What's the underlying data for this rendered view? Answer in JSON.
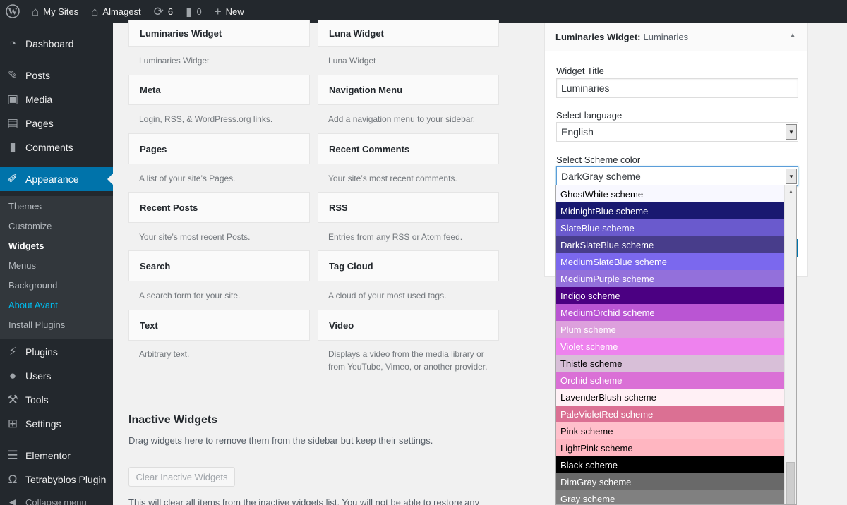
{
  "adminbar": {
    "my_sites": "My Sites",
    "site_name": "Almagest",
    "updates_count": "6",
    "comments_count": "0",
    "new_label": "New"
  },
  "sidebar": {
    "menu": [
      {
        "label": "Dashboard",
        "icon": "dashboard-icon"
      },
      {
        "label": "Posts",
        "icon": "pin-icon"
      },
      {
        "label": "Media",
        "icon": "media-icon"
      },
      {
        "label": "Pages",
        "icon": "pages-icon"
      },
      {
        "label": "Comments",
        "icon": "comment-icon"
      },
      {
        "label": "Appearance",
        "icon": "brush-icon"
      },
      {
        "label": "Plugins",
        "icon": "plugin-icon"
      },
      {
        "label": "Users",
        "icon": "user-icon"
      },
      {
        "label": "Tools",
        "icon": "wrench-icon"
      },
      {
        "label": "Settings",
        "icon": "settings-icon"
      },
      {
        "label": "Elementor",
        "icon": "elementor-icon"
      },
      {
        "label": "Tetrabyblos Plugin",
        "icon": "omega-icon"
      }
    ],
    "submenu": [
      "Themes",
      "Customize",
      "Widgets",
      "Menus",
      "Background",
      "About Avant",
      "Install Plugins"
    ],
    "collapse": "Collapse menu"
  },
  "widgets": [
    {
      "title": "Luminaries Widget",
      "desc": "Luminaries Widget"
    },
    {
      "title": "Luna Widget",
      "desc": "Luna Widget"
    },
    {
      "title": "Meta",
      "desc": "Login, RSS, & WordPress.org links."
    },
    {
      "title": "Navigation Menu",
      "desc": "Add a navigation menu to your sidebar."
    },
    {
      "title": "Pages",
      "desc": "A list of your site’s Pages."
    },
    {
      "title": "Recent Comments",
      "desc": "Your site’s most recent comments."
    },
    {
      "title": "Recent Posts",
      "desc": "Your site’s most recent Posts."
    },
    {
      "title": "RSS",
      "desc": "Entries from any RSS or Atom feed."
    },
    {
      "title": "Search",
      "desc": "A search form for your site."
    },
    {
      "title": "Tag Cloud",
      "desc": "A cloud of your most used tags."
    },
    {
      "title": "Text",
      "desc": "Arbitrary text."
    },
    {
      "title": "Video",
      "desc": "Displays a video from the media library or from YouTube, Vimeo, or another provider."
    }
  ],
  "inactive": {
    "title": "Inactive Widgets",
    "desc": "Drag widgets here to remove them from the sidebar but keep their settings.",
    "clear_button": "Clear Inactive Widgets",
    "note": "This will clear all items from the inactive widgets list. You will not be able to restore any"
  },
  "panel": {
    "title": "Luminaries Widget:",
    "subtitle": "Luminaries",
    "widget_title_label": "Widget Title",
    "widget_title_value": "Luminaries",
    "language_label": "Select language",
    "language_value": "English",
    "scheme_label": "Select Scheme color",
    "scheme_value": "DarkGray scheme"
  },
  "scheme_options": [
    {
      "label": "GhostWhite scheme",
      "bg": "#f8f8ff",
      "fg": "#000000"
    },
    {
      "label": "MidnightBlue scheme",
      "bg": "#191970",
      "fg": "#ffffff"
    },
    {
      "label": "SlateBlue scheme",
      "bg": "#6a5acd",
      "fg": "#ffffff"
    },
    {
      "label": "DarkSlateBlue scheme",
      "bg": "#483d8b",
      "fg": "#ffffff"
    },
    {
      "label": "MediumSlateBlue scheme",
      "bg": "#7b68ee",
      "fg": "#ffffff"
    },
    {
      "label": "MediumPurple scheme",
      "bg": "#9370db",
      "fg": "#ffffff"
    },
    {
      "label": "Indigo scheme",
      "bg": "#4b0082",
      "fg": "#ffffff"
    },
    {
      "label": "MediumOrchid scheme",
      "bg": "#ba55d3",
      "fg": "#ffffff"
    },
    {
      "label": "Plum scheme",
      "bg": "#dda0dd",
      "fg": "#ffffff"
    },
    {
      "label": "Violet scheme",
      "bg": "#ee82ee",
      "fg": "#ffffff"
    },
    {
      "label": "Thistle scheme",
      "bg": "#d8bfd8",
      "fg": "#000000"
    },
    {
      "label": "Orchid scheme",
      "bg": "#da70d6",
      "fg": "#ffffff"
    },
    {
      "label": "LavenderBlush scheme",
      "bg": "#fff0f5",
      "fg": "#000000"
    },
    {
      "label": "PaleVioletRed scheme",
      "bg": "#db7093",
      "fg": "#ffffff"
    },
    {
      "label": "Pink scheme",
      "bg": "#ffc0cb",
      "fg": "#000000"
    },
    {
      "label": "LightPink scheme",
      "bg": "#ffb6c1",
      "fg": "#000000"
    },
    {
      "label": "Black scheme",
      "bg": "#000000",
      "fg": "#ffffff"
    },
    {
      "label": "DimGray scheme",
      "bg": "#696969",
      "fg": "#ffffff"
    },
    {
      "label": "Gray scheme",
      "bg": "#808080",
      "fg": "#ffffff"
    }
  ]
}
